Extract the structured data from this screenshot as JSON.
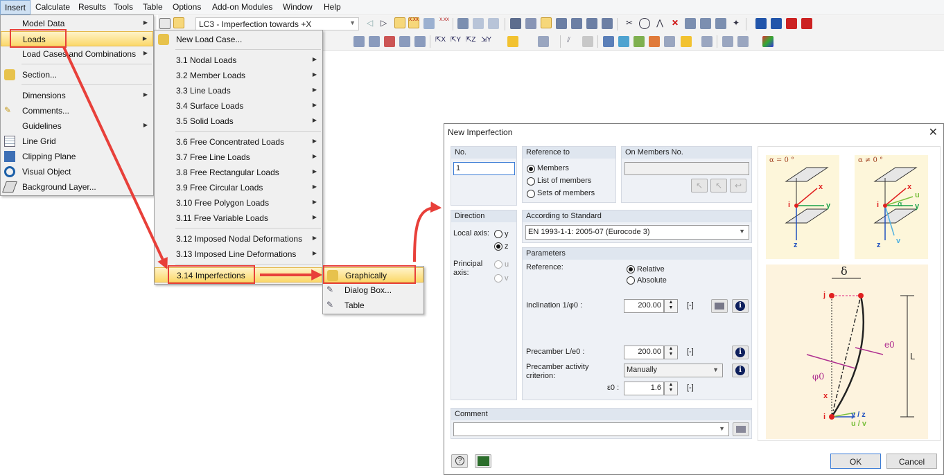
{
  "menubar": {
    "items": [
      "Insert",
      "Calculate",
      "Results",
      "Tools",
      "Table",
      "Options",
      "Add-on Modules",
      "Window",
      "Help"
    ]
  },
  "toolbar": {
    "load_case": "LC3 - Imperfection towards +X",
    "xyz_label": "X.XX"
  },
  "insert_menu": {
    "items": [
      "Model Data",
      "Loads",
      "Load Cases and Combinations",
      "Section...",
      "Dimensions",
      "Comments...",
      "Guidelines",
      "Line Grid",
      "Clipping Plane",
      "Visual Object",
      "Background Layer..."
    ]
  },
  "loads_menu": {
    "items": [
      "New Load Case...",
      "3.1 Nodal Loads",
      "3.2 Member Loads",
      "3.3 Line Loads",
      "3.4 Surface Loads",
      "3.5 Solid Loads",
      "3.6 Free Concentrated Loads",
      "3.7 Free Line Loads",
      "3.8 Free Rectangular Loads",
      "3.9 Free Circular Loads",
      "3.10 Free Polygon Loads",
      "3.11 Free Variable Loads",
      "3.12 Imposed Nodal Deformations",
      "3.13 Imposed Line Deformations",
      "3.14 Imperfections"
    ]
  },
  "imperfections_menu": {
    "items": [
      "Graphically",
      "Dialog Box...",
      "Table"
    ]
  },
  "dialog": {
    "title": "New Imperfection",
    "close": "✕",
    "no_label": "No.",
    "no_value": "1",
    "reference_to": {
      "header": "Reference to",
      "options": [
        "Members",
        "List of members",
        "Sets of members"
      ]
    },
    "on_members": {
      "header": "On Members No.",
      "value": ""
    },
    "direction": {
      "header": "Direction",
      "local_axis": "Local axis:",
      "principal_axis": "Principal axis:",
      "local_opts": [
        "y",
        "z"
      ],
      "principal_opts": [
        "u",
        "v"
      ]
    },
    "standard": {
      "header": "According to Standard",
      "value": "EN 1993-1-1: 2005-07  (Eurocode 3)"
    },
    "parameters": {
      "header": "Parameters",
      "reference_label": "Reference:",
      "relative": "Relative",
      "absolute": "Absolute",
      "inclination_label": "Inclination 1/φ0 :",
      "inclination_value": "200.00",
      "precamber_label": "Precamber L/e0 :",
      "precamber_value": "200.00",
      "criterion_label": "Precamber activity criterion:",
      "criterion_value": "Manually",
      "eps_label": "ε0 :",
      "eps_value": "1.6",
      "unit": "[-]"
    },
    "comment": {
      "header": "Comment",
      "value": ""
    },
    "ok": "OK",
    "cancel": "Cancel",
    "diagram": {
      "alpha0": "α = 0 °",
      "alpha_ne": "α ≠ 0 °",
      "delta": "δ",
      "e0": "e0",
      "phi0": "φ0",
      "L": "L",
      "x": "x",
      "y": "y",
      "z": "z",
      "u": "u",
      "v": "v",
      "alpha": "α",
      "i": "i",
      "j": "j",
      "yz": "y / z",
      "uv": "u / v"
    }
  }
}
